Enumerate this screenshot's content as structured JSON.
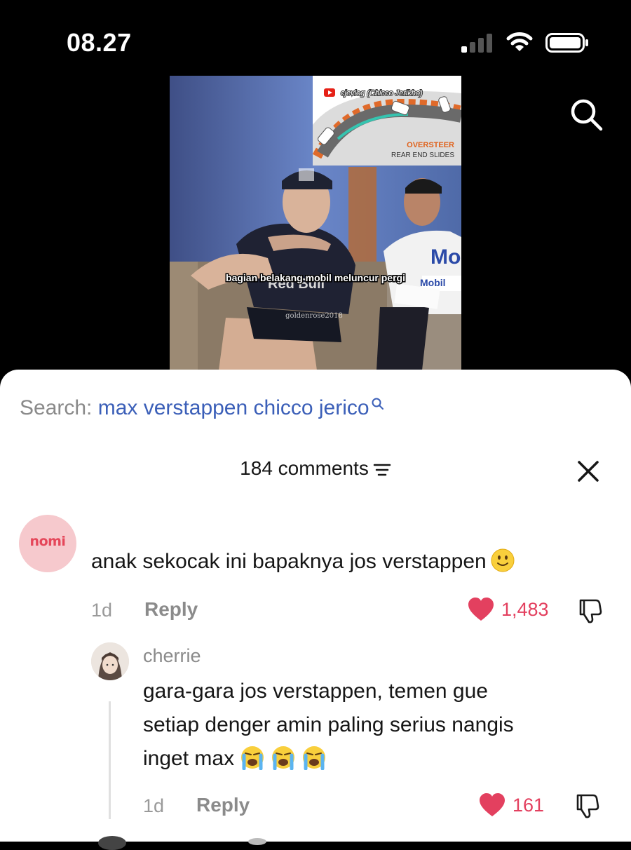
{
  "status_bar": {
    "time": "08.27"
  },
  "video": {
    "channel": "cjevlog (Chicco Jerikho)",
    "diagram_title": "OVERSTEER",
    "diagram_subtitle": "REAR END SLIDES",
    "caption": "bagian belakang mobil meluncur pergi",
    "watermark": "goldenrose2018",
    "shirt_brand": "Red Bull",
    "shirt_brand2": "Mobil",
    "shirt_logo": "Mo"
  },
  "search": {
    "label": "Search:",
    "query": "max verstappen chicco jerico"
  },
  "comments_header": {
    "count_label": "184 comments"
  },
  "comments": [
    {
      "avatar_text": "nomi",
      "text": "anak sekocak ini bapaknya jos verstappen",
      "age": "1d",
      "reply_label": "Reply",
      "likes": "1,483"
    }
  ],
  "replies": [
    {
      "user": "cherrie",
      "lines": [
        "gara-gara jos verstappen, temen gue",
        "setiap denger amin paling serius nangis",
        "inget max"
      ],
      "age": "1d",
      "reply_label": "Reply",
      "likes": "161"
    }
  ],
  "icons": {
    "search": "search-icon",
    "sort": "sort-icon",
    "close": "close-icon",
    "like": "heart-icon",
    "dislike": "thumbs-down-icon",
    "emoji_smile": "slightly-smiling-face-emoji",
    "emoji_cry": "loudly-crying-face-emoji"
  },
  "colors": {
    "accent": "#e3405f",
    "query": "#3b5fb8",
    "nomi": "#e5475a"
  }
}
